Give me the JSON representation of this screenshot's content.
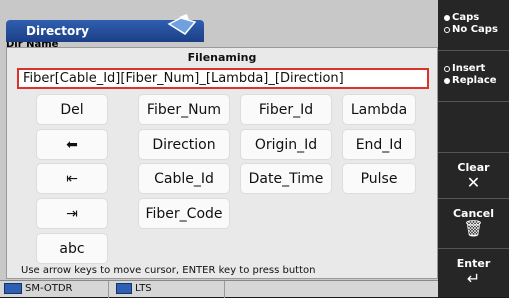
{
  "window": {
    "title": "Directory",
    "subheader": "Dir Name"
  },
  "dialog": {
    "title": "Filenaming",
    "filename_value": "Fiber[Cable_Id][Fiber_Num]_[Lambda]_[Direction]",
    "hint": "Use arrow keys to move cursor, ENTER key to press button"
  },
  "keys": {
    "del": "Del",
    "fiber_num": "Fiber_Num",
    "fiber_id": "Fiber_Id",
    "lambda": "Lambda",
    "backspace": "⬅",
    "direction": "Direction",
    "origin_id": "Origin_Id",
    "end_id": "End_Id",
    "home": "⇤",
    "cable_id": "Cable_Id",
    "date_time": "Date_Time",
    "pulse": "Pulse",
    "end": "⇥",
    "fiber_code": "Fiber_Code",
    "abc": "abc"
  },
  "right_panel": {
    "case": {
      "caps": "Caps",
      "no_caps": "No Caps",
      "selected": "caps"
    },
    "mode": {
      "insert": "Insert",
      "replace": "Replace",
      "selected": "replace"
    },
    "clear": "Clear",
    "cancel": "Cancel",
    "enter": "Enter",
    "clear_icon": "✕",
    "cancel_icon": "🗑",
    "enter_icon": "↵"
  },
  "status_bar": {
    "module": "SM-OTDR",
    "mode": "LTS"
  },
  "colors": {
    "field_border": "#d9332b",
    "title_blue": "#2f5fb0",
    "panel_dark": "#262626"
  }
}
